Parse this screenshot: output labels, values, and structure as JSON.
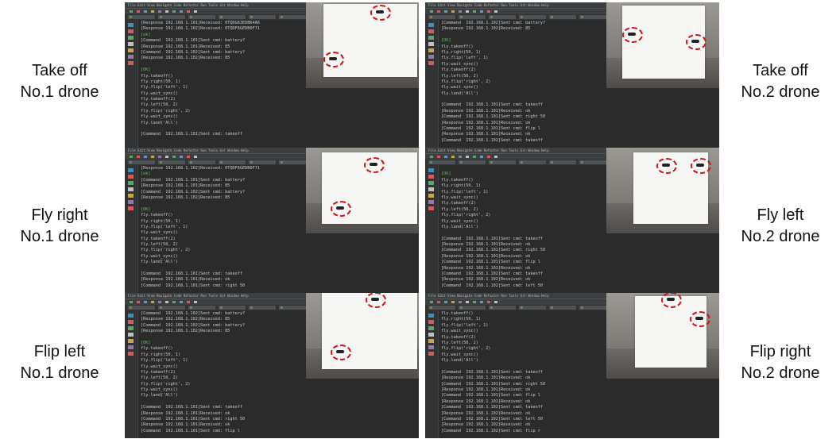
{
  "labels": {
    "left": [
      {
        "action": "Take off",
        "drone": "No.1 drone"
      },
      {
        "action": "Fly right",
        "drone": "No.1 drone"
      },
      {
        "action": "Flip left",
        "drone": "No.1 drone"
      }
    ],
    "right": [
      {
        "action": "Take off",
        "drone": "No.2 drone"
      },
      {
        "action": "Fly left",
        "drone": "No.2 drone"
      },
      {
        "action": "Flip right",
        "drone": "No.2 drone"
      }
    ]
  },
  "menubar": "File  Edit  View  Navigate  Code  Refactor  Run  Tools  Git  Window  Help",
  "panels": {
    "l1": [
      "[Response 192.168.1.101]Received: 0TQDG63EDBK4A6",
      "[Response 192.168.1.102]Received: 0TQDF6GEDB0F71",
      "[ok]",
      "[Command  192.168.1.101]Sent cmd: battery?",
      "[Response 192.168.1.101]Received: 85",
      "[Command  192.168.1.102]Sent cmd: battery?",
      "[Response 192.168.1.102]Received: 85",
      "",
      "[OK]",
      "fly.takeoff()",
      "fly.right(50, 1)",
      "fly.flip('left', 1)",
      "fly.wait_sync()",
      "fly.takeoff(2)",
      "fly.left(50, 2)",
      "fly.flip('right', 2)",
      "fly.wait_sync()",
      "fly.land('All')",
      "",
      "[Command  192.168.1.101]Sent cmd: takeoff"
    ],
    "r1": [
      "[Command  192.168.1.102]Sent cmd: battery?",
      "[Response 192.168.1.102]Received: 85",
      "",
      "[OK]",
      "fly.takeoff()",
      "fly.right(50, 1)",
      "fly.flip('left', 1)",
      "fly.wait_sync()",
      "fly.takeoff(2)",
      "fly.left(50, 2)",
      "fly.flip('right', 2)",
      "fly.wait_sync()",
      "fly.land('All')",
      "",
      "[Command  192.168.1.101]Sent cmd: takeoff",
      "[Response 192.168.1.101]Received: ok",
      "[Command  192.168.1.101]Sent cmd: right 50",
      "[Response 192.168.1.101]Received: ok",
      "[Command  192.168.1.101]Sent cmd: flip l",
      "[Response 192.168.1.101]Received: ok",
      "[Command  192.168.1.102]Sent cmd: takeoff"
    ],
    "l2": [
      "[Response 192.168.1.102]Received: 0TQDF6GEDB0F71",
      "[ok]",
      "[Command  192.168.1.101]Sent cmd: battery?",
      "[Response 192.168.1.101]Received: 85",
      "[Command  192.168.1.102]Sent cmd: battery?",
      "[Response 192.168.1.102]Received: 85",
      "",
      "[OK]",
      "fly.takeoff()",
      "fly.right(50, 1)",
      "fly.flip('left', 1)",
      "fly.wait_sync()",
      "fly.takeoff(2)",
      "fly.left(50, 2)",
      "fly.flip('right', 2)",
      "fly.wait_sync()",
      "fly.land('All')",
      "",
      "[Command  192.168.1.101]Sent cmd: takeoff",
      "[Response 192.168.1.101]Received: ok",
      "[Command  192.168.1.101]Sent cmd: right 50"
    ],
    "r2": [
      "",
      "[OK]",
      "fly.takeoff()",
      "fly.right(50, 1)",
      "fly.flip('left', 1)",
      "fly.wait_sync()",
      "fly.takeoff(2)",
      "fly.left(50, 2)",
      "fly.flip('right', 2)",
      "fly.wait_sync()",
      "fly.land('All')",
      "",
      "[Command  192.168.1.101]Sent cmd: takeoff",
      "[Response 192.168.1.101]Received: ok",
      "[Command  192.168.1.101]Sent cmd: right 50",
      "[Response 192.168.1.101]Received: ok",
      "[Command  192.168.1.101]Sent cmd: flip l",
      "[Response 192.168.1.101]Received: ok",
      "[Command  192.168.1.102]Sent cmd: takeoff",
      "[Response 192.168.1.102]Received: ok",
      "[Command  192.168.1.102]Sent cmd: left 50"
    ],
    "l3": [
      "[Command  192.168.1.102]Sent cmd: battery?",
      "[Response 192.168.1.102]Received: 85",
      "[Command  192.168.1.102]Sent cmd: battery?",
      "[Response 192.168.1.102]Received: 85",
      "",
      "[OK]",
      "fly.takeoff()",
      "fly.right(50, 1)",
      "fly.flip('left', 1)",
      "fly.wait_sync()",
      "fly.takeoff(2)",
      "fly.left(50, 2)",
      "fly.flip('right', 2)",
      "fly.wait_sync()",
      "fly.land('All')",
      "",
      "[Command  192.168.1.101]Sent cmd: takeoff",
      "[Response 192.168.1.101]Received: ok",
      "[Command  192.168.1.101]Sent cmd: right 50",
      "[Response 192.168.1.101]Received: ok",
      "[Command  192.168.1.101]Sent cmd: flip l"
    ],
    "r3": [
      "fly.takeoff()",
      "fly.right(50, 1)",
      "fly.flip('left', 1)",
      "fly.wait_sync()",
      "fly.takeoff(2)",
      "fly.left(50, 2)",
      "fly.flip('right', 2)",
      "fly.wait_sync()",
      "fly.land('All')",
      "",
      "[Command  192.168.1.101]Sent cmd: takeoff",
      "[Response 192.168.1.101]Received: ok",
      "[Command  192.168.1.101]Sent cmd: right 50",
      "[Response 192.168.1.101]Received: ok",
      "[Command  192.168.1.101]Sent cmd: flip l",
      "[Response 192.168.1.101]Received: ok",
      "[Command  192.168.1.102]Sent cmd: takeoff",
      "[Response 192.168.1.102]Received: ok",
      "[Command  192.168.1.102]Sent cmd: left 50",
      "[Response 192.168.1.102]Received: ok",
      "[Command  192.168.1.102]Sent cmd: flip r"
    ]
  },
  "colors": {
    "ide_bg": "#2b2b2b",
    "highlight": "#6bba6b",
    "ring": "#d11414",
    "sheet": "#f6f6f4"
  }
}
